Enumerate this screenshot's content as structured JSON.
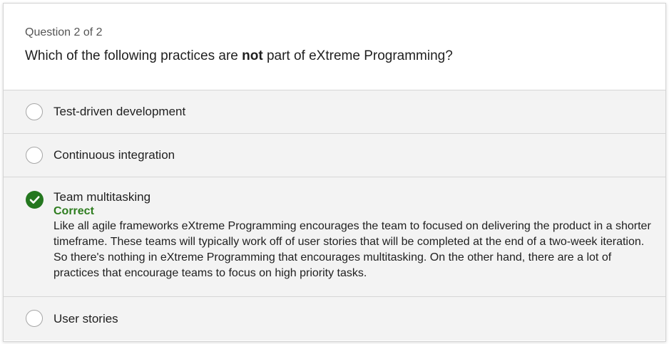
{
  "question": {
    "counter": "Question 2 of 2",
    "text_before": "Which of the following practices are ",
    "text_bold": "not",
    "text_after": " part of eXtreme Programming?"
  },
  "options": [
    {
      "label": "Test-driven development",
      "selected": false
    },
    {
      "label": "Continuous integration",
      "selected": false
    },
    {
      "label": "Team multitasking",
      "selected": true,
      "status": "Correct",
      "explanation": "Like all agile frameworks eXtreme Programming encourages the team to focused on delivering the product in a shorter timeframe. These teams will typically work off of user stories that will be completed at the end of a two-week iteration. So there's nothing in eXtreme Programming that encourages multitasking. On the other hand, there are a lot of practices that encourage teams to focus on high priority tasks."
    },
    {
      "label": "User stories",
      "selected": false
    }
  ],
  "colors": {
    "correct": "#24771f",
    "option_bg": "#f3f3f3"
  }
}
